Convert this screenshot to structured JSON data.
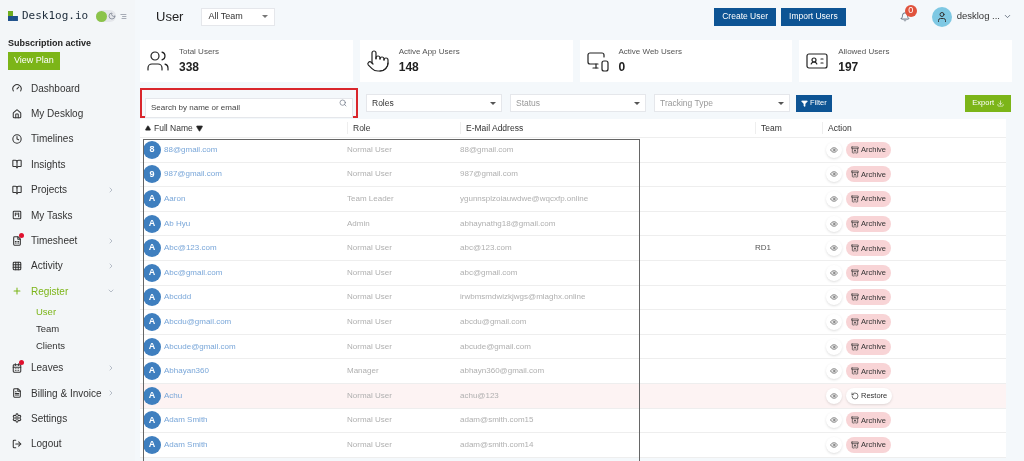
{
  "sidebar": {
    "brand": "Desk1og.io",
    "subscription": "Subscription active",
    "plan_button": "View Plan",
    "dark_mode": false,
    "items": [
      {
        "label": "Dashboard",
        "selected": false,
        "has_arrow": false,
        "dot": false
      },
      {
        "label": "My Desklog",
        "selected": false,
        "has_arrow": false,
        "dot": false
      },
      {
        "label": "Timelines",
        "selected": false,
        "has_arrow": false,
        "dot": false
      },
      {
        "label": "Insights",
        "selected": false,
        "has_arrow": false,
        "dot": false
      },
      {
        "label": "Projects",
        "selected": false,
        "has_arrow": true,
        "dot": false
      },
      {
        "label": "My Tasks",
        "selected": false,
        "has_arrow": false,
        "dot": false
      },
      {
        "label": "Timesheet",
        "selected": false,
        "has_arrow": true,
        "dot": true
      },
      {
        "label": "Activity",
        "selected": false,
        "has_arrow": true,
        "dot": false
      },
      {
        "label": "Register",
        "selected": true,
        "has_arrow": true,
        "dot": false,
        "expanded": true,
        "children": [
          {
            "label": "User",
            "selected": true
          },
          {
            "label": "Team",
            "selected": false
          },
          {
            "label": "Clients",
            "selected": false
          }
        ]
      },
      {
        "label": "Leaves",
        "selected": false,
        "has_arrow": true,
        "dot": true
      },
      {
        "label": "Billing & Invoice",
        "selected": false,
        "has_arrow": true,
        "dot": false
      },
      {
        "label": "Settings",
        "selected": false,
        "has_arrow": false,
        "dot": false
      },
      {
        "label": "Logout",
        "selected": false,
        "has_arrow": false,
        "dot": false
      }
    ]
  },
  "header": {
    "title": "User",
    "team_select": "All Team",
    "buttons": [
      "Create User",
      "Import Users"
    ],
    "notifications": "0",
    "account": "desklog ..."
  },
  "stats": [
    {
      "label": "Total Users",
      "value": "338"
    },
    {
      "label": "Active App Users",
      "value": "148"
    },
    {
      "label": "Active Web Users",
      "value": "0"
    },
    {
      "label": "Allowed Users",
      "value": "197"
    }
  ],
  "filters": {
    "search": {
      "placeholder": "Search by name or email",
      "highlighted": true
    },
    "selects": [
      {
        "placeholder": "Roles"
      },
      {
        "placeholder": "Status"
      },
      {
        "placeholder": "Tracking Type"
      }
    ],
    "filter_button": "Filter",
    "export_button": "Export"
  },
  "table": {
    "columns": [
      "Full Name",
      "Role",
      "E-Mail Address",
      "Team",
      "Action"
    ],
    "names_highlighted": true,
    "rows": [
      {
        "avatar": "8",
        "name": "88@gmail.com",
        "role": "Normal User",
        "email": "88@gmail.com",
        "team": "",
        "archived": false,
        "action": "Archive"
      },
      {
        "avatar": "9",
        "name": "987@gmail.com",
        "role": "Normal User",
        "email": "987@gmail.com",
        "team": "",
        "archived": false,
        "action": "Archive"
      },
      {
        "avatar": "A",
        "name": "Aaron",
        "role": "Team Leader",
        "email": "ygunnsplzoiauwdwe@wqcxfp.online",
        "team": "",
        "archived": false,
        "action": "Archive"
      },
      {
        "avatar": "A",
        "name": "Ab Hyu",
        "role": "Admin",
        "email": "abhaynathg18@gmail.com",
        "team": "",
        "archived": false,
        "action": "Archive"
      },
      {
        "avatar": "A",
        "name": "Abc@123.com",
        "role": "Normal User",
        "email": "abc@123.com",
        "team": "RD1",
        "archived": false,
        "action": "Archive"
      },
      {
        "avatar": "A",
        "name": "Abc@gmail.com",
        "role": "Normal User",
        "email": "abc@gmail.com",
        "team": "",
        "archived": false,
        "action": "Archive"
      },
      {
        "avatar": "A",
        "name": "Abcddd",
        "role": "Normal User",
        "email": "irwbmsmdwizkjwgs@mlaghx.online",
        "team": "",
        "archived": false,
        "action": "Archive"
      },
      {
        "avatar": "A",
        "name": "Abcdu@gmail.com",
        "role": "Normal User",
        "email": "abcdu@gmail.com",
        "team": "",
        "archived": false,
        "action": "Archive"
      },
      {
        "avatar": "A",
        "name": "Abcude@gmail.com",
        "role": "Normal User",
        "email": "abcude@gmail.com",
        "team": "",
        "archived": false,
        "action": "Archive"
      },
      {
        "avatar": "A",
        "name": "Abhayan360",
        "role": "Manager",
        "email": "abhayn360@gmail.com",
        "team": "",
        "archived": false,
        "action": "Archive"
      },
      {
        "avatar": "A",
        "name": "Achu",
        "role": "Normal User",
        "email": "achu@123",
        "team": "",
        "archived": true,
        "action": "Restore"
      },
      {
        "avatar": "A",
        "name": "Adam Smith",
        "role": "Normal User",
        "email": "adam@smith.com15",
        "team": "",
        "archived": false,
        "action": "Archive"
      },
      {
        "avatar": "A",
        "name": "Adam Smith",
        "role": "Normal User",
        "email": "adam@smith.com14",
        "team": "",
        "archived": false,
        "action": "Archive"
      }
    ]
  }
}
